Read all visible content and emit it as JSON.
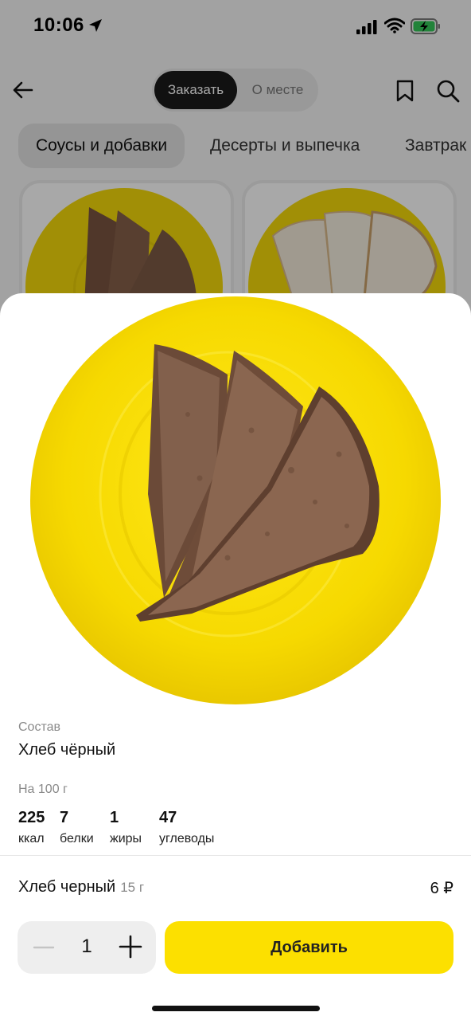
{
  "status_bar": {
    "time": "10:06"
  },
  "nav": {
    "tab_active": "Заказать",
    "tab_inactive": "О месте"
  },
  "categories": [
    "Соусы и добавки",
    "Десерты и выпечка",
    "Завтрак"
  ],
  "product": {
    "composition_label": "Состав",
    "composition": "Хлеб чёрный",
    "per_label": "На 100 г",
    "nutrients": [
      {
        "value": "225",
        "unit": "ккал"
      },
      {
        "value": "7",
        "unit": "белки"
      },
      {
        "value": "1",
        "unit": "жиры"
      },
      {
        "value": "47",
        "unit": "углеводы"
      }
    ],
    "name": "Хлеб черный",
    "weight": "15 г",
    "price": "6 ₽"
  },
  "order": {
    "quantity": "1",
    "add_label": "Добавить"
  },
  "colors": {
    "accent": "#fce000",
    "plate": "#f4d90a"
  }
}
